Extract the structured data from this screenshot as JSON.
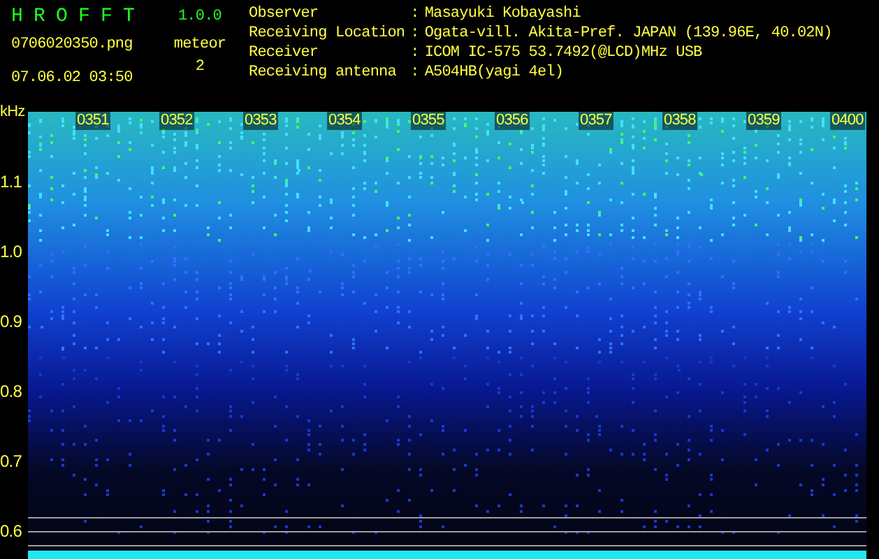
{
  "header": {
    "title": "H R O F F T",
    "version": "1.0.0",
    "filename": "0706020350.png",
    "datetime": "07.06.02 03:50",
    "meteor_label": "meteor",
    "meteor_count": "2"
  },
  "info": [
    {
      "label": "Observer",
      "sep": ":",
      "value": "Masayuki Kobayashi"
    },
    {
      "label": "Receiving Location",
      "sep": ":",
      "value": "Ogata-vill. Akita-Pref. JAPAN (139.96E, 40.02N)"
    },
    {
      "label": "Receiver",
      "sep": ":",
      "value": "ICOM IC-575 53.7492(@LCD)MHz USB"
    },
    {
      "label": "Receiving antenna",
      "sep": ":",
      "value": "A504HB(yagi 4el)"
    }
  ],
  "spectrogram": {
    "unit": "kHz",
    "y_labels": [
      "1.1",
      "1.0",
      "0.9",
      "0.8",
      "0.7",
      "0.6"
    ],
    "time_labels": [
      "0351",
      "0352",
      "0353",
      "0354",
      "0355",
      "0356",
      "0357",
      "0358",
      "0359",
      "0400"
    ]
  }
}
